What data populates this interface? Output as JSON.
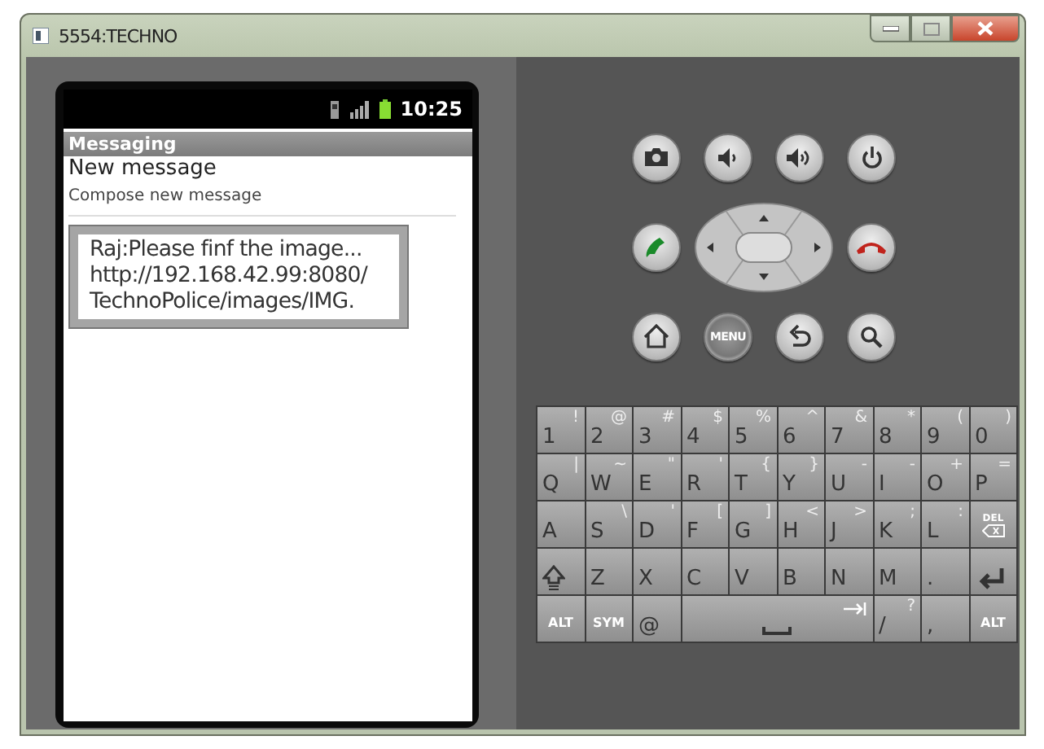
{
  "window": {
    "title": "5554:TECHNO"
  },
  "phone": {
    "status_time": "10:25",
    "app_title": "Messaging",
    "notification_title": "New message",
    "notification_text": "Compose new message",
    "popup_lines": [
      "Raj:Please finf the image...",
      "http://192.168.42.99:8080/",
      "TechnoPolice/images/IMG."
    ]
  },
  "hardware_buttons": [
    {
      "kind": "camera"
    },
    {
      "kind": "volume_down"
    },
    {
      "kind": "volume_up"
    },
    {
      "kind": "power"
    },
    {
      "kind": "call"
    },
    {
      "kind": "dpad"
    },
    {
      "kind": "end_call"
    },
    {
      "kind": "home"
    },
    {
      "kind": "menu",
      "label": "MENU"
    },
    {
      "kind": "back"
    },
    {
      "kind": "search"
    }
  ],
  "keyboard": {
    "rows": [
      [
        {
          "kind": "char",
          "label": "1",
          "alt": "!"
        },
        {
          "kind": "char",
          "label": "2",
          "alt": "@"
        },
        {
          "kind": "char",
          "label": "3",
          "alt": "#"
        },
        {
          "kind": "char",
          "label": "4",
          "alt": "$"
        },
        {
          "kind": "char",
          "label": "5",
          "alt": "%"
        },
        {
          "kind": "char",
          "label": "6",
          "alt": "^"
        },
        {
          "kind": "char",
          "label": "7",
          "alt": "&"
        },
        {
          "kind": "char",
          "label": "8",
          "alt": "*"
        },
        {
          "kind": "char",
          "label": "9",
          "alt": "("
        },
        {
          "kind": "char",
          "label": "0",
          "alt": ")"
        }
      ],
      [
        {
          "kind": "char",
          "label": "Q",
          "alt": "|"
        },
        {
          "kind": "char",
          "label": "W",
          "alt": "~"
        },
        {
          "kind": "char",
          "label": "E",
          "alt": "\""
        },
        {
          "kind": "char",
          "label": "R",
          "alt": "'"
        },
        {
          "kind": "char",
          "label": "T",
          "alt": "{"
        },
        {
          "kind": "char",
          "label": "Y",
          "alt": "}"
        },
        {
          "kind": "char",
          "label": "U",
          "alt": "-"
        },
        {
          "kind": "char",
          "label": "I",
          "alt": "-"
        },
        {
          "kind": "char",
          "label": "O",
          "alt": "+"
        },
        {
          "kind": "char",
          "label": "P",
          "alt": "="
        }
      ],
      [
        {
          "kind": "char",
          "label": "A"
        },
        {
          "kind": "char",
          "label": "S",
          "alt": "\\"
        },
        {
          "kind": "char",
          "label": "D",
          "alt": "'"
        },
        {
          "kind": "char",
          "label": "F",
          "alt": "["
        },
        {
          "kind": "char",
          "label": "G",
          "alt": "]"
        },
        {
          "kind": "char",
          "label": "H",
          "alt": "<"
        },
        {
          "kind": "char",
          "label": "J",
          "alt": ">"
        },
        {
          "kind": "char",
          "label": "K",
          "alt": ";"
        },
        {
          "kind": "char",
          "label": "L",
          "alt": ":"
        },
        {
          "kind": "delete",
          "label": "DEL"
        }
      ],
      [
        {
          "kind": "shift"
        },
        {
          "kind": "char",
          "label": "Z"
        },
        {
          "kind": "char",
          "label": "X"
        },
        {
          "kind": "char",
          "label": "C"
        },
        {
          "kind": "char",
          "label": "V"
        },
        {
          "kind": "char",
          "label": "B"
        },
        {
          "kind": "char",
          "label": "N"
        },
        {
          "kind": "char",
          "label": "M"
        },
        {
          "kind": "char",
          "label": "."
        },
        {
          "kind": "enter"
        }
      ]
    ],
    "bottom_row": {
      "left": [
        {
          "kind": "mod",
          "label": "ALT"
        },
        {
          "kind": "mod",
          "label": "SYM"
        },
        {
          "kind": "char",
          "label": "@"
        }
      ],
      "space": {
        "kind": "space"
      },
      "right": [
        {
          "kind": "char",
          "label": "/",
          "alt": "?"
        },
        {
          "kind": "char",
          "label": ","
        },
        {
          "kind": "mod",
          "label": "ALT"
        }
      ]
    }
  }
}
